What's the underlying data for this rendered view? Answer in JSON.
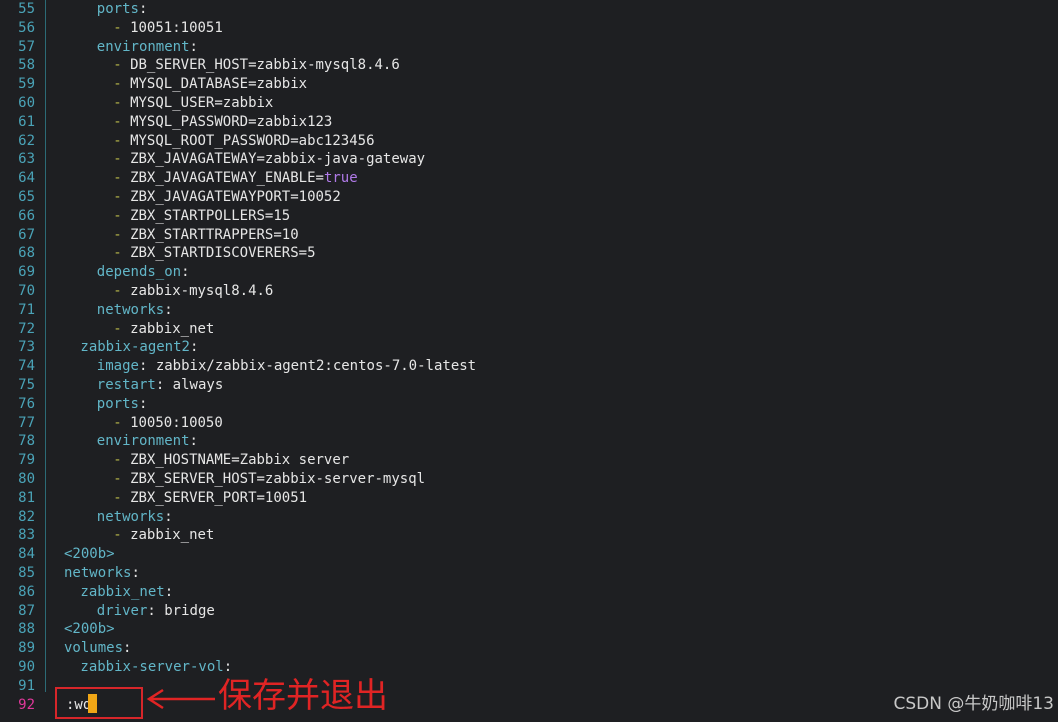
{
  "lines": [
    {
      "n": "55",
      "indent": 4,
      "key": "ports",
      "colon": ":"
    },
    {
      "n": "56",
      "indent": 6,
      "dash": "-",
      "val": "10051:10051"
    },
    {
      "n": "57",
      "indent": 4,
      "key": "environment",
      "colon": ":"
    },
    {
      "n": "58",
      "indent": 6,
      "dash": "-",
      "val": "DB_SERVER_HOST=zabbix-mysql8.4.6"
    },
    {
      "n": "59",
      "indent": 6,
      "dash": "-",
      "val": "MYSQL_DATABASE=zabbix"
    },
    {
      "n": "60",
      "indent": 6,
      "dash": "-",
      "val": "MYSQL_USER=zabbix"
    },
    {
      "n": "61",
      "indent": 6,
      "dash": "-",
      "val": "MYSQL_PASSWORD=zabbix123"
    },
    {
      "n": "62",
      "indent": 6,
      "dash": "-",
      "val": "MYSQL_ROOT_PASSWORD=abc123456"
    },
    {
      "n": "63",
      "indent": 6,
      "dash": "-",
      "val": "ZBX_JAVAGATEWAY=zabbix-java-gateway"
    },
    {
      "n": "64",
      "indent": 6,
      "dash": "-",
      "val": "ZBX_JAVAGATEWAY_ENABLE=",
      "bool": "true"
    },
    {
      "n": "65",
      "indent": 6,
      "dash": "-",
      "val": "ZBX_JAVAGATEWAYPORT=10052"
    },
    {
      "n": "66",
      "indent": 6,
      "dash": "-",
      "val": "ZBX_STARTPOLLERS=15"
    },
    {
      "n": "67",
      "indent": 6,
      "dash": "-",
      "val": "ZBX_STARTTRAPPERS=10"
    },
    {
      "n": "68",
      "indent": 6,
      "dash": "-",
      "val": "ZBX_STARTDISCOVERERS=5"
    },
    {
      "n": "69",
      "indent": 4,
      "key": "depends_on",
      "colon": ":"
    },
    {
      "n": "70",
      "indent": 6,
      "dash": "-",
      "val": "zabbix-mysql8.4.6"
    },
    {
      "n": "71",
      "indent": 4,
      "key": "networks",
      "colon": ":"
    },
    {
      "n": "72",
      "indent": 6,
      "dash": "-",
      "val": "zabbix_net"
    },
    {
      "n": "73",
      "indent": 2,
      "key": "zabbix-agent2",
      "colon": ":"
    },
    {
      "n": "74",
      "indent": 4,
      "key": "image",
      "colon": ":",
      "val": " zabbix/zabbix-agent2:centos-7.0-latest"
    },
    {
      "n": "75",
      "indent": 4,
      "key": "restart",
      "colon": ":",
      "val": " always"
    },
    {
      "n": "76",
      "indent": 4,
      "key": "ports",
      "colon": ":"
    },
    {
      "n": "77",
      "indent": 6,
      "dash": "-",
      "val": "10050:10050"
    },
    {
      "n": "78",
      "indent": 4,
      "key": "environment",
      "colon": ":"
    },
    {
      "n": "79",
      "indent": 6,
      "dash": "-",
      "val": "ZBX_HOSTNAME=Zabbix server"
    },
    {
      "n": "80",
      "indent": 6,
      "dash": "-",
      "val": "ZBX_SERVER_HOST=zabbix-server-mysql"
    },
    {
      "n": "81",
      "indent": 6,
      "dash": "-",
      "val": "ZBX_SERVER_PORT=10051"
    },
    {
      "n": "82",
      "indent": 4,
      "key": "networks",
      "colon": ":"
    },
    {
      "n": "83",
      "indent": 6,
      "dash": "-",
      "val": "zabbix_net"
    },
    {
      "n": "84",
      "indent": 0,
      "tag": "<200b>"
    },
    {
      "n": "85",
      "indent": 0,
      "key": "networks",
      "colon": ":"
    },
    {
      "n": "86",
      "indent": 2,
      "key": "zabbix_net",
      "colon": ":"
    },
    {
      "n": "87",
      "indent": 4,
      "key": "driver",
      "colon": ":",
      "val": " bridge"
    },
    {
      "n": "88",
      "indent": 0,
      "tag": "<200b>"
    },
    {
      "n": "89",
      "indent": 0,
      "key": "volumes",
      "colon": ":"
    },
    {
      "n": "90",
      "indent": 2,
      "key": "zabbix-server-vol",
      "colon": ":"
    },
    {
      "n": "91",
      "indent": 0
    }
  ],
  "command_line": {
    "line_number": "92",
    "text": ":wq"
  },
  "annotation": {
    "text": "保存并退出",
    "color": "#e02424"
  },
  "watermark": "CSDN @牛奶咖啡13",
  "colors": {
    "background": "#1e1f22",
    "key": "#62b6c8",
    "dash": "#b8b84a",
    "boolean": "#b07ae8",
    "line_number": "#4aa3b7",
    "current_line_number": "#e0389b",
    "cursor": "#f0a616"
  }
}
